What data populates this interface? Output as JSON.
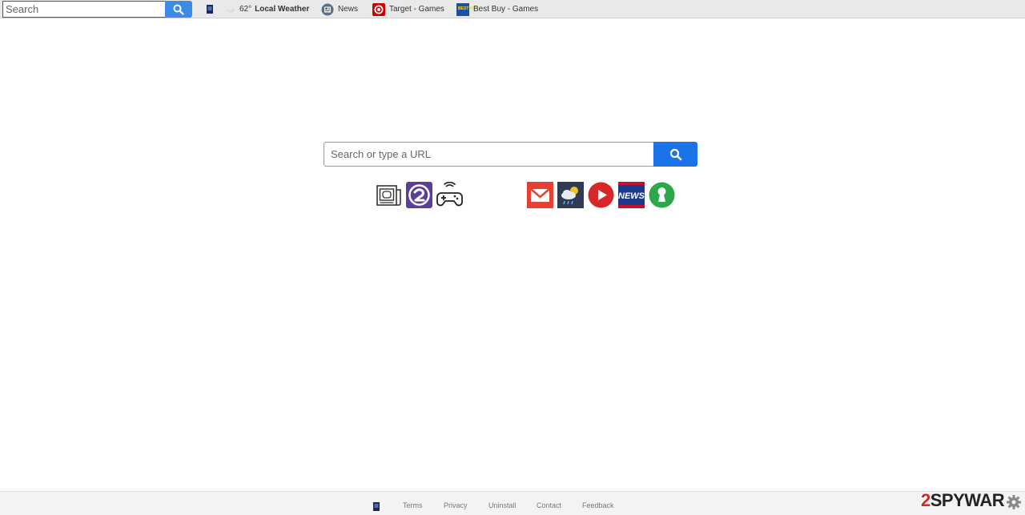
{
  "toolbar": {
    "search": {
      "placeholder": "Search"
    },
    "weather": {
      "temp": "62°",
      "label": "Local Weather"
    },
    "news": {
      "label": "News"
    },
    "target": {
      "label": "Target - Games"
    },
    "bestbuy": {
      "label": "Best Buy - Games",
      "logo_text": "BEST BUY"
    }
  },
  "main": {
    "search": {
      "placeholder": "Search or type a URL"
    },
    "tiles": [
      {
        "name": "news-tile",
        "icon": "newspaper-icon"
      },
      {
        "name": "game-tile",
        "icon": "letter-g-icon"
      },
      {
        "name": "controller-tile",
        "icon": "gamepad-icon"
      },
      {
        "name": "gmail-tile",
        "icon": "gmail-icon"
      },
      {
        "name": "weather-tile",
        "icon": "weather-icon"
      },
      {
        "name": "youtube-tile",
        "icon": "play-icon"
      },
      {
        "name": "news-brand-tile",
        "icon": "news-icon",
        "text": "NEWS"
      },
      {
        "name": "user-tile",
        "icon": "person-icon"
      }
    ]
  },
  "footer": {
    "links": [
      "Terms",
      "Privacy",
      "Uninstall",
      "Contact",
      "Feedback"
    ]
  },
  "watermark": {
    "two": "2",
    "rest": "SPYWAR"
  },
  "colors": {
    "accent": "#1a73e8",
    "toolbar_bg": "#e9e9e9",
    "gmail": "#e44134",
    "youtube": "#d62828",
    "news_brand": "#1b3a8c",
    "user_green": "#2aa84a",
    "purple": "#5c3d99",
    "target_red": "#cc0000"
  }
}
